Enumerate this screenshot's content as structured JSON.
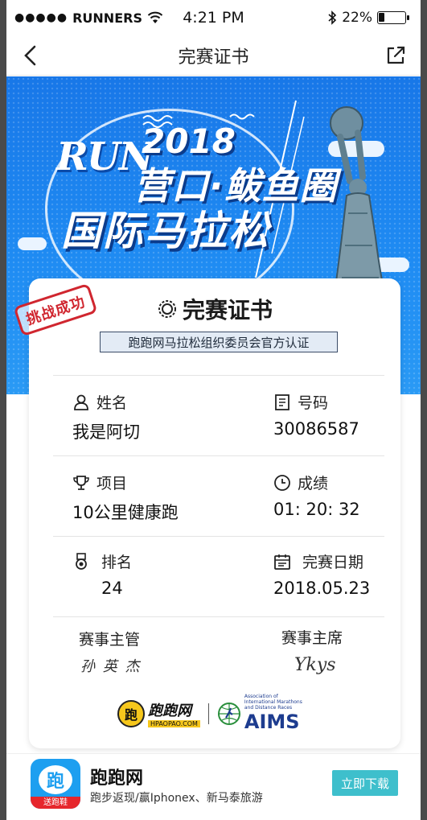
{
  "status_bar": {
    "carrier": "RUNNERS",
    "signal_dots": "●●●●●",
    "time": "4:21 PM",
    "battery": "22%",
    "battery_level": 0.22
  },
  "nav": {
    "title": "完赛证书",
    "back_icon": "chevron-left-icon",
    "share_icon": "share-icon"
  },
  "hero": {
    "logo_text": "RUN",
    "year": "2018",
    "city": "营口·鲅鱼圈",
    "event": "国际马拉松"
  },
  "certificate": {
    "stamp": "挑战成功",
    "title": "完赛证书",
    "ribbon": "跑跑网马拉松组织委员会官方认证",
    "fields": {
      "name_label": "姓名",
      "name_value": "我是阿切",
      "number_label": "号码",
      "number_value": "30086587",
      "event_label": "项目",
      "event_value": "10公里健康跑",
      "result_label": "成绩",
      "result_value": "01: 20: 32",
      "rank_label": "排名",
      "rank_value": "24",
      "date_label": "完赛日期",
      "date_value": "2018.05.23"
    },
    "signatures": {
      "supervisor_label": "赛事主管",
      "supervisor_sign": "孙 英 杰",
      "chairman_label": "赛事主席",
      "chairman_sign": "Ykys"
    },
    "logos": {
      "ppw_text": "跑跑网",
      "ppw_sub": "HPAOPAO.COM",
      "ppw_badge": "跑",
      "aims_text": "AIMS",
      "aims_small": "Association of International Marathons and Distance Races"
    }
  },
  "banner": {
    "app_icon_char": "跑",
    "app_icon_tag": "送跑鞋",
    "app_name": "跑跑网",
    "app_desc": "跑步返现/赢Iphonex、新马泰旅游",
    "download": "立即下载"
  }
}
